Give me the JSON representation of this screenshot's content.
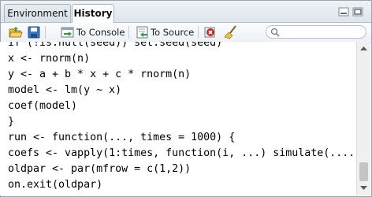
{
  "tabs": [
    {
      "label": "Environment",
      "active": false
    },
    {
      "label": "History",
      "active": true
    }
  ],
  "toolbar": {
    "load_icon": "open-folder-icon",
    "save_icon": "save-icon",
    "to_console_label": "To Console",
    "to_console_icon": "to-console-icon",
    "to_source_label": "To Source",
    "to_source_icon": "to-source-icon",
    "remove_icon": "remove-entry-icon",
    "clear_icon": "broom-icon",
    "search_icon": "search-icon",
    "search_placeholder": ""
  },
  "history": {
    "lines": [
      "if (!is.null(seed)) set.seed(seed)",
      "x <- rnorm(n)",
      "y <- a + b * x + c * rnorm(n)",
      "model <- lm(y ~ x)",
      "coef(model)",
      "}",
      "run <- function(..., times = 1000) {",
      "coefs <- vapply(1:times, function(i, ...) simulate(....",
      "oldpar <- par(mfrow = c(1,2))",
      "on.exit(oldpar)"
    ]
  },
  "colors": {
    "accent_blue": "#3c78c3",
    "remove_red": "#cc2222",
    "folder_yellow": "#e9b93b"
  }
}
